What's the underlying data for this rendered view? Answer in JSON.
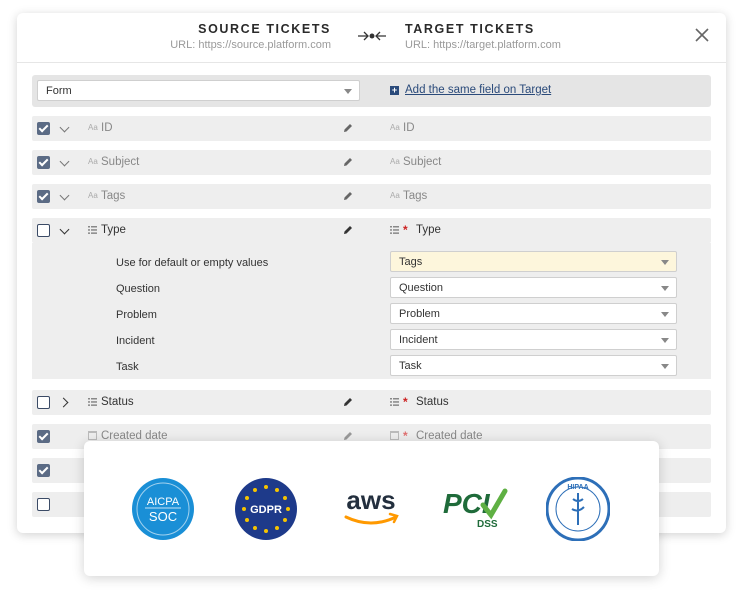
{
  "header": {
    "source_title": "SOURCE TICKETS",
    "source_url": "URL: https://source.platform.com",
    "target_title": "TARGET TICKETS",
    "target_url": "URL: https://target.platform.com"
  },
  "form_bar": {
    "select_value": "Form",
    "add_link": "Add the same field on Target"
  },
  "fields": [
    {
      "source": "ID",
      "target": "ID",
      "checked": true
    },
    {
      "source": "Subject",
      "target": "Subject",
      "checked": true
    },
    {
      "source": "Tags",
      "target": "Tags",
      "checked": true
    },
    {
      "source": "Type",
      "target": "Type",
      "checked": false
    },
    {
      "source": "Status",
      "target": "Status",
      "checked": false
    },
    {
      "source": "Created date",
      "target": "Created date",
      "checked": true
    },
    {
      "checked": true
    },
    {
      "checked": false
    }
  ],
  "type_mappings": [
    {
      "label": "Use for default or empty values",
      "value": "Tags"
    },
    {
      "label": "Question",
      "value": "Question"
    },
    {
      "label": "Problem",
      "value": "Problem"
    },
    {
      "label": "Incident",
      "value": "Incident"
    },
    {
      "label": "Task",
      "value": "Task"
    }
  ],
  "badges": {
    "aicpa_line1": "AICPA",
    "aicpa_line2": "SOC",
    "gdpr": "GDPR",
    "aws": "aws",
    "pci": "PCI",
    "pci_sub": "DSS",
    "hipaa": "HIPAA"
  },
  "colors": {
    "checkbox": "#5b6b85",
    "required": "#cc2222",
    "default_select_bg": "#fdf6dc",
    "link": "#2a4a7a"
  }
}
